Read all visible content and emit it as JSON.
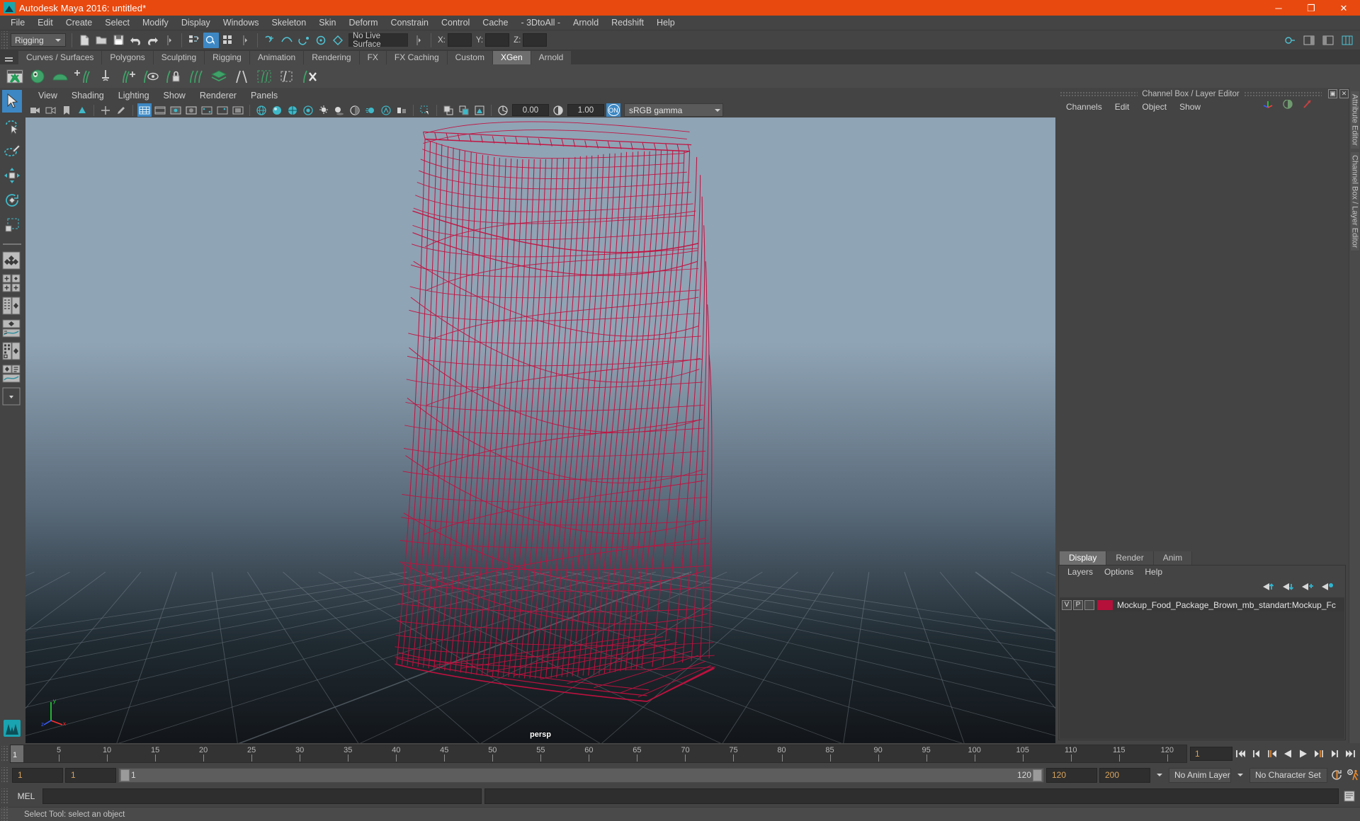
{
  "window": {
    "title": "Autodesk Maya 2016: untitled*",
    "icon": "maya-logo-icon",
    "buttons": [
      {
        "name": "minimize",
        "glyph": "─"
      },
      {
        "name": "maximize",
        "glyph": "❐"
      },
      {
        "name": "close",
        "glyph": "✕"
      }
    ]
  },
  "menubar": {
    "items": [
      "File",
      "Edit",
      "Create",
      "Select",
      "Modify",
      "Display",
      "Windows",
      "Skeleton",
      "Skin",
      "Deform",
      "Constrain",
      "Control",
      "Cache",
      "- 3DtoAll -",
      "Arnold",
      "Redshift",
      "Help"
    ]
  },
  "statusbar": {
    "menu_set": "Rigging",
    "live_surface": "No Live Surface",
    "coord_labels": [
      "X:",
      "Y:",
      "Z:"
    ],
    "coord_values": [
      "",
      "",
      ""
    ]
  },
  "shelf": {
    "tabs": [
      "Curves / Surfaces",
      "Polygons",
      "Sculpting",
      "Rigging",
      "Animation",
      "Rendering",
      "FX",
      "FX Caching",
      "Custom",
      "XGen",
      "Arnold"
    ],
    "active_tab": "XGen"
  },
  "viewport": {
    "menus": [
      "View",
      "Shading",
      "Lighting",
      "Show",
      "Renderer",
      "Panels"
    ],
    "exposure": "0.00",
    "gamma": "1.00",
    "color_management": "sRGB gamma",
    "color_management_enabled": "ON",
    "camera_label": "persp",
    "axis_labels": [
      "y",
      "x",
      "z"
    ],
    "mesh_color": "#c01040",
    "background_top": "#8fa4b5",
    "background_bottom": "#121519"
  },
  "channel_box": {
    "panel_title": "Channel Box / Layer Editor",
    "menus": [
      "Channels",
      "Edit",
      "Object",
      "Show"
    ],
    "window_buttons": [
      "restore",
      "close"
    ],
    "side_tabs": [
      "Attribute Editor",
      "Channel Box / Layer Editor"
    ]
  },
  "layer_editor": {
    "tabs": [
      "Display",
      "Render",
      "Anim"
    ],
    "active_tab": "Display",
    "menus": [
      "Layers",
      "Options",
      "Help"
    ],
    "buttons": [
      "move-layer-up",
      "move-layer-down",
      "create-new-layer",
      "create-layer-from-selected"
    ],
    "layers": [
      {
        "visibility": "V",
        "playback": "P",
        "state": "",
        "color": "#b5103a",
        "name": "Mockup_Food_Package_Brown_mb_standart:Mockup_Fc"
      }
    ]
  },
  "timeline": {
    "current_frame": "1",
    "ticks": [
      5,
      10,
      15,
      20,
      25,
      30,
      35,
      40,
      45,
      50,
      55,
      60,
      65,
      70,
      75,
      80,
      85,
      90,
      95,
      100,
      105,
      110,
      115,
      120
    ],
    "range_start_visible": "1",
    "range_end_visible": "120",
    "frame_field": "1",
    "start_field": "1",
    "end_field": "1",
    "range_start": "120",
    "range_end": "200",
    "anim_layer": "No Anim Layer",
    "character_set": "No Character Set",
    "playback_buttons": [
      "go-to-start",
      "step-back-key",
      "step-back-frame",
      "play-backwards",
      "play-forwards",
      "step-forward-frame",
      "step-forward-key",
      "go-to-end"
    ]
  },
  "command_line": {
    "language": "MEL",
    "input_value": "",
    "output_value": ""
  },
  "help_line": {
    "text": "Select Tool: select an object"
  }
}
